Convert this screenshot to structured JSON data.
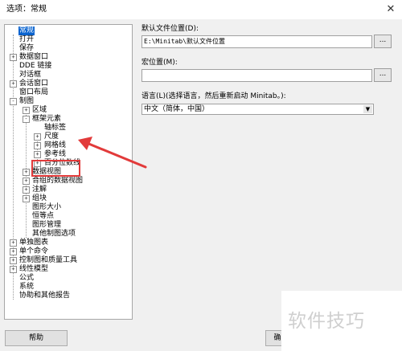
{
  "window": {
    "title": "选项：常规",
    "close_glyph": "✕"
  },
  "tree": {
    "items": [
      {
        "label": "常规",
        "expander": "",
        "selected": true
      },
      {
        "label": "打开",
        "expander": ""
      },
      {
        "label": "保存",
        "expander": ""
      },
      {
        "label": "数据窗口",
        "expander": "+"
      },
      {
        "label": "DDE 链接",
        "expander": ""
      },
      {
        "label": "对话框",
        "expander": ""
      },
      {
        "label": "会话窗口",
        "expander": "+"
      },
      {
        "label": "窗口布局",
        "expander": ""
      },
      {
        "label": "制图",
        "expander": "-"
      },
      {
        "label": "区域",
        "expander": "+"
      },
      {
        "label": "框架元素",
        "expander": "-"
      },
      {
        "label": "轴标签",
        "expander": ""
      },
      {
        "label": "尺度",
        "expander": "+"
      },
      {
        "label": "网格线",
        "expander": "+"
      },
      {
        "label": "参考线",
        "expander": "+"
      },
      {
        "label": "百分位数线",
        "expander": "+"
      },
      {
        "label": "数据视图",
        "expander": "+"
      },
      {
        "label": "合组的数据视图",
        "expander": "+"
      },
      {
        "label": "注解",
        "expander": "+"
      },
      {
        "label": "组块",
        "expander": "+"
      },
      {
        "label": "图形大小",
        "expander": ""
      },
      {
        "label": "恒等点",
        "expander": ""
      },
      {
        "label": "图形管理",
        "expander": ""
      },
      {
        "label": "其他制图选项",
        "expander": ""
      },
      {
        "label": "单独图表",
        "expander": "+"
      },
      {
        "label": "单个命令",
        "expander": "+"
      },
      {
        "label": "控制图和质量工具",
        "expander": "+"
      },
      {
        "label": "线性模型",
        "expander": "+"
      },
      {
        "label": "公式",
        "expander": ""
      },
      {
        "label": "系统",
        "expander": ""
      },
      {
        "label": "协助和其他报告",
        "expander": ""
      }
    ]
  },
  "settings": {
    "default_location_label": "默认文件位置(D):",
    "default_location_value": "E:\\Minitab\\默认文件位置",
    "macro_location_label": "宏位置(M):",
    "macro_location_value": "",
    "browse_label": "...",
    "language_label": "语言(L)(选择语言，然后重新启动 Minitab。):",
    "language_value": "中文（简体，中国）",
    "caret_glyph": "▼"
  },
  "buttons": {
    "help": "帮助",
    "ok_partial": "确"
  },
  "watermark": {
    "text": "软件技巧"
  },
  "annotation": {
    "color": "#e23a3a"
  }
}
